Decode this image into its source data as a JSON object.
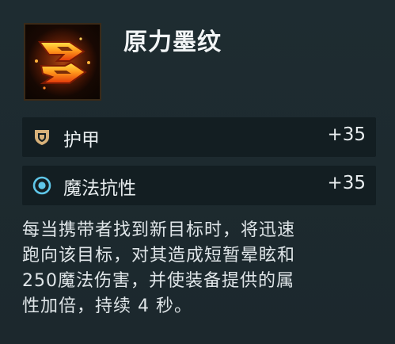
{
  "item": {
    "name": "原力墨纹",
    "icon": "flame-rune-icon"
  },
  "stats": [
    {
      "icon": "shield-icon",
      "label": "护甲",
      "value": "+35",
      "color": "#d9b27a"
    },
    {
      "icon": "magic-resist-icon",
      "label": "魔法抗性",
      "value": "+35",
      "color": "#5fc6e8"
    }
  ],
  "description": {
    "lines": [
      "每当携带者找到新目标时，将迅速",
      "跑向该目标，对其造成短暂晕眩和",
      "250魔法伤害，并使装备提供的属",
      "性加倍，持续 4 秒。"
    ]
  }
}
